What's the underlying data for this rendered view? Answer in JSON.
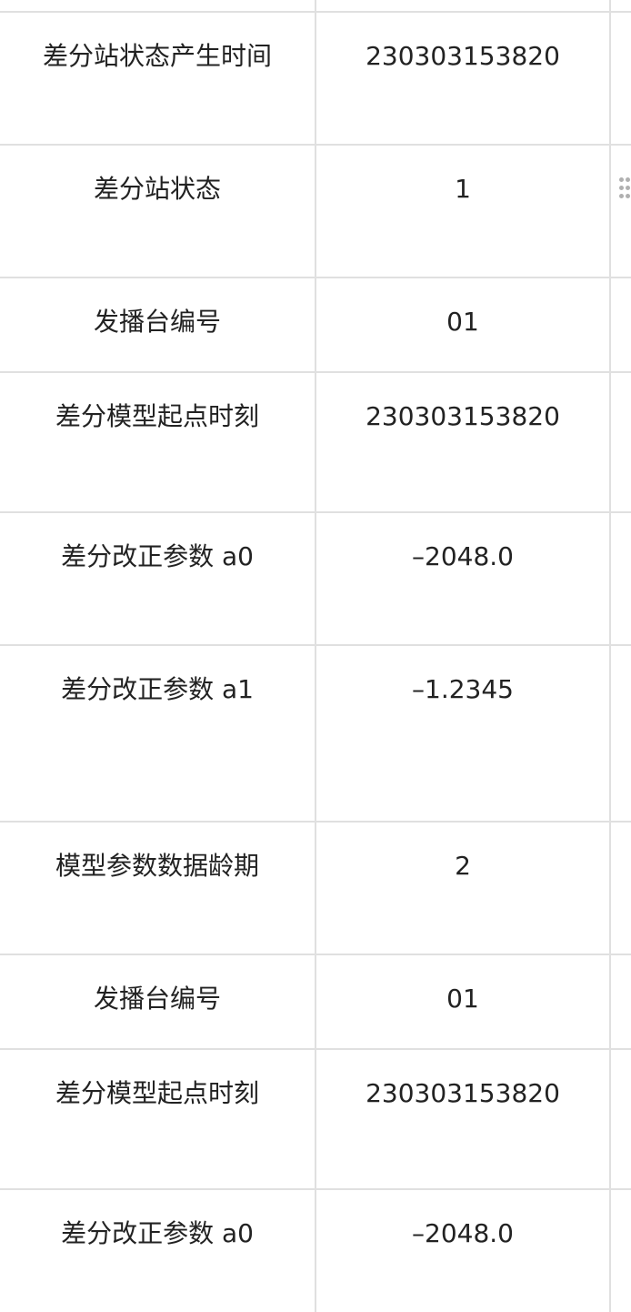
{
  "table": {
    "rows": [
      {
        "label": "差分站状态产生时间",
        "value": "230303153820"
      },
      {
        "label": "差分站状态",
        "value": "1"
      },
      {
        "label": "发播台编号",
        "value": "01"
      },
      {
        "label": "差分模型起点时刻",
        "value": "230303153820"
      },
      {
        "label": "差分改正参数 a0",
        "value": "–2048.0"
      },
      {
        "label": "差分改正参数 a1",
        "value": "–1.2345"
      },
      {
        "label": "模型参数数据龄期",
        "value": "2"
      },
      {
        "label": "发播台编号",
        "value": "01"
      },
      {
        "label": "差分模型起点时刻",
        "value": "230303153820"
      },
      {
        "label": "差分改正参数 a0",
        "value": "–2048.0"
      }
    ]
  },
  "icons": {
    "drag_handle": "drag-handle-icon"
  }
}
